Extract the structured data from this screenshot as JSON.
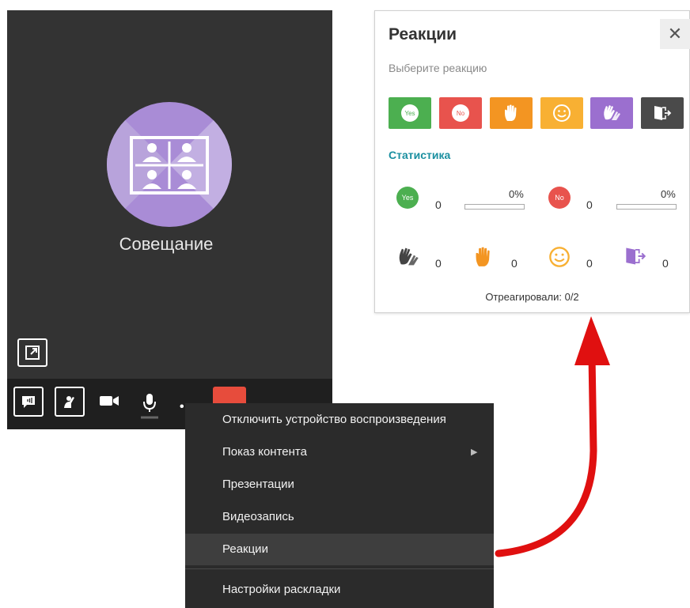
{
  "video": {
    "meeting_title": "Совещание"
  },
  "menu": {
    "items": [
      {
        "label": "Отключить устройство воспроизведения"
      },
      {
        "label": "Показ контента",
        "submenu_arrow": "▶"
      },
      {
        "label": "Презентации"
      },
      {
        "label": "Видеозапись"
      },
      {
        "label": "Реакции",
        "active": true
      },
      {
        "label": "Настройки раскладки"
      }
    ]
  },
  "panel": {
    "title": "Реакции",
    "close": "✕",
    "subtitle": "Выберите реакцию",
    "reaction_buttons": [
      {
        "name": "yes",
        "label": "Yes",
        "color": "#4caf50"
      },
      {
        "name": "no",
        "label": "No",
        "color": "#e8534d"
      },
      {
        "name": "hand",
        "color": "#f39522"
      },
      {
        "name": "smile",
        "color": "#f8b033"
      },
      {
        "name": "clap",
        "color": "#9b6fcf"
      },
      {
        "name": "exit",
        "color": "#4a4a4a"
      }
    ],
    "stats_title": "Статистика",
    "stats": {
      "yes": {
        "label": "Yes",
        "count": "0",
        "percent": "0%"
      },
      "no": {
        "label": "No",
        "count": "0",
        "percent": "0%"
      },
      "clap": {
        "count": "0"
      },
      "hand": {
        "count": "0"
      },
      "smile": {
        "count": "0"
      },
      "exit": {
        "count": "0"
      }
    },
    "responded": "Отреагировали: 0/2"
  },
  "colors": {
    "accent_teal": "#1a8fa0",
    "end_call_red": "#e74c3c",
    "arrow_red": "#e01010"
  }
}
